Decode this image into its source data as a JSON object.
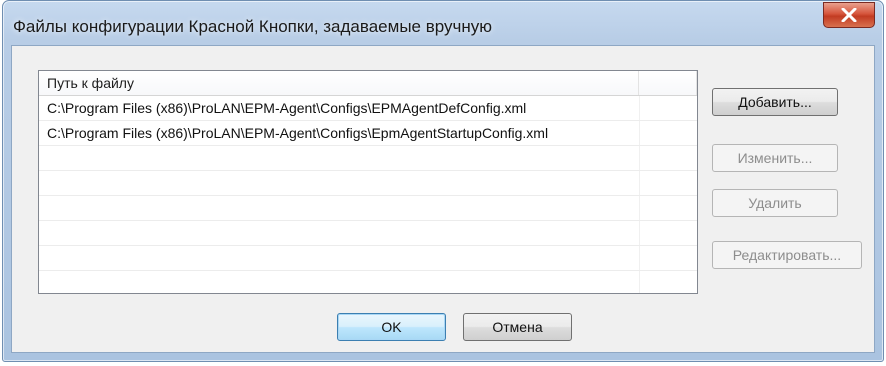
{
  "window": {
    "title": "Файлы конфигурации Красной Кнопки, задаваемые вручную",
    "close_icon": "close-x-icon"
  },
  "list": {
    "column_header": "Путь к файлу",
    "rows": [
      {
        "path": "C:\\Program Files (x86)\\ProLAN\\EPM-Agent\\Configs\\EPMAgentDefConfig.xml"
      },
      {
        "path": "C:\\Program Files (x86)\\ProLAN\\EPM-Agent\\Configs\\EpmAgentStartupConfig.xml"
      },
      {
        "path": ""
      },
      {
        "path": ""
      },
      {
        "path": ""
      },
      {
        "path": ""
      },
      {
        "path": ""
      },
      {
        "path": ""
      }
    ]
  },
  "buttons": {
    "add": "Добавить...",
    "edit": "Изменить...",
    "delete": "Удалить",
    "editor": "Редактировать...",
    "ok": "OK",
    "cancel": "Отмена"
  },
  "colors": {
    "frame": "#b8cde6",
    "client": "#f0f0f0",
    "close_button": "#c23b22",
    "default_button": "#bee6fd"
  }
}
